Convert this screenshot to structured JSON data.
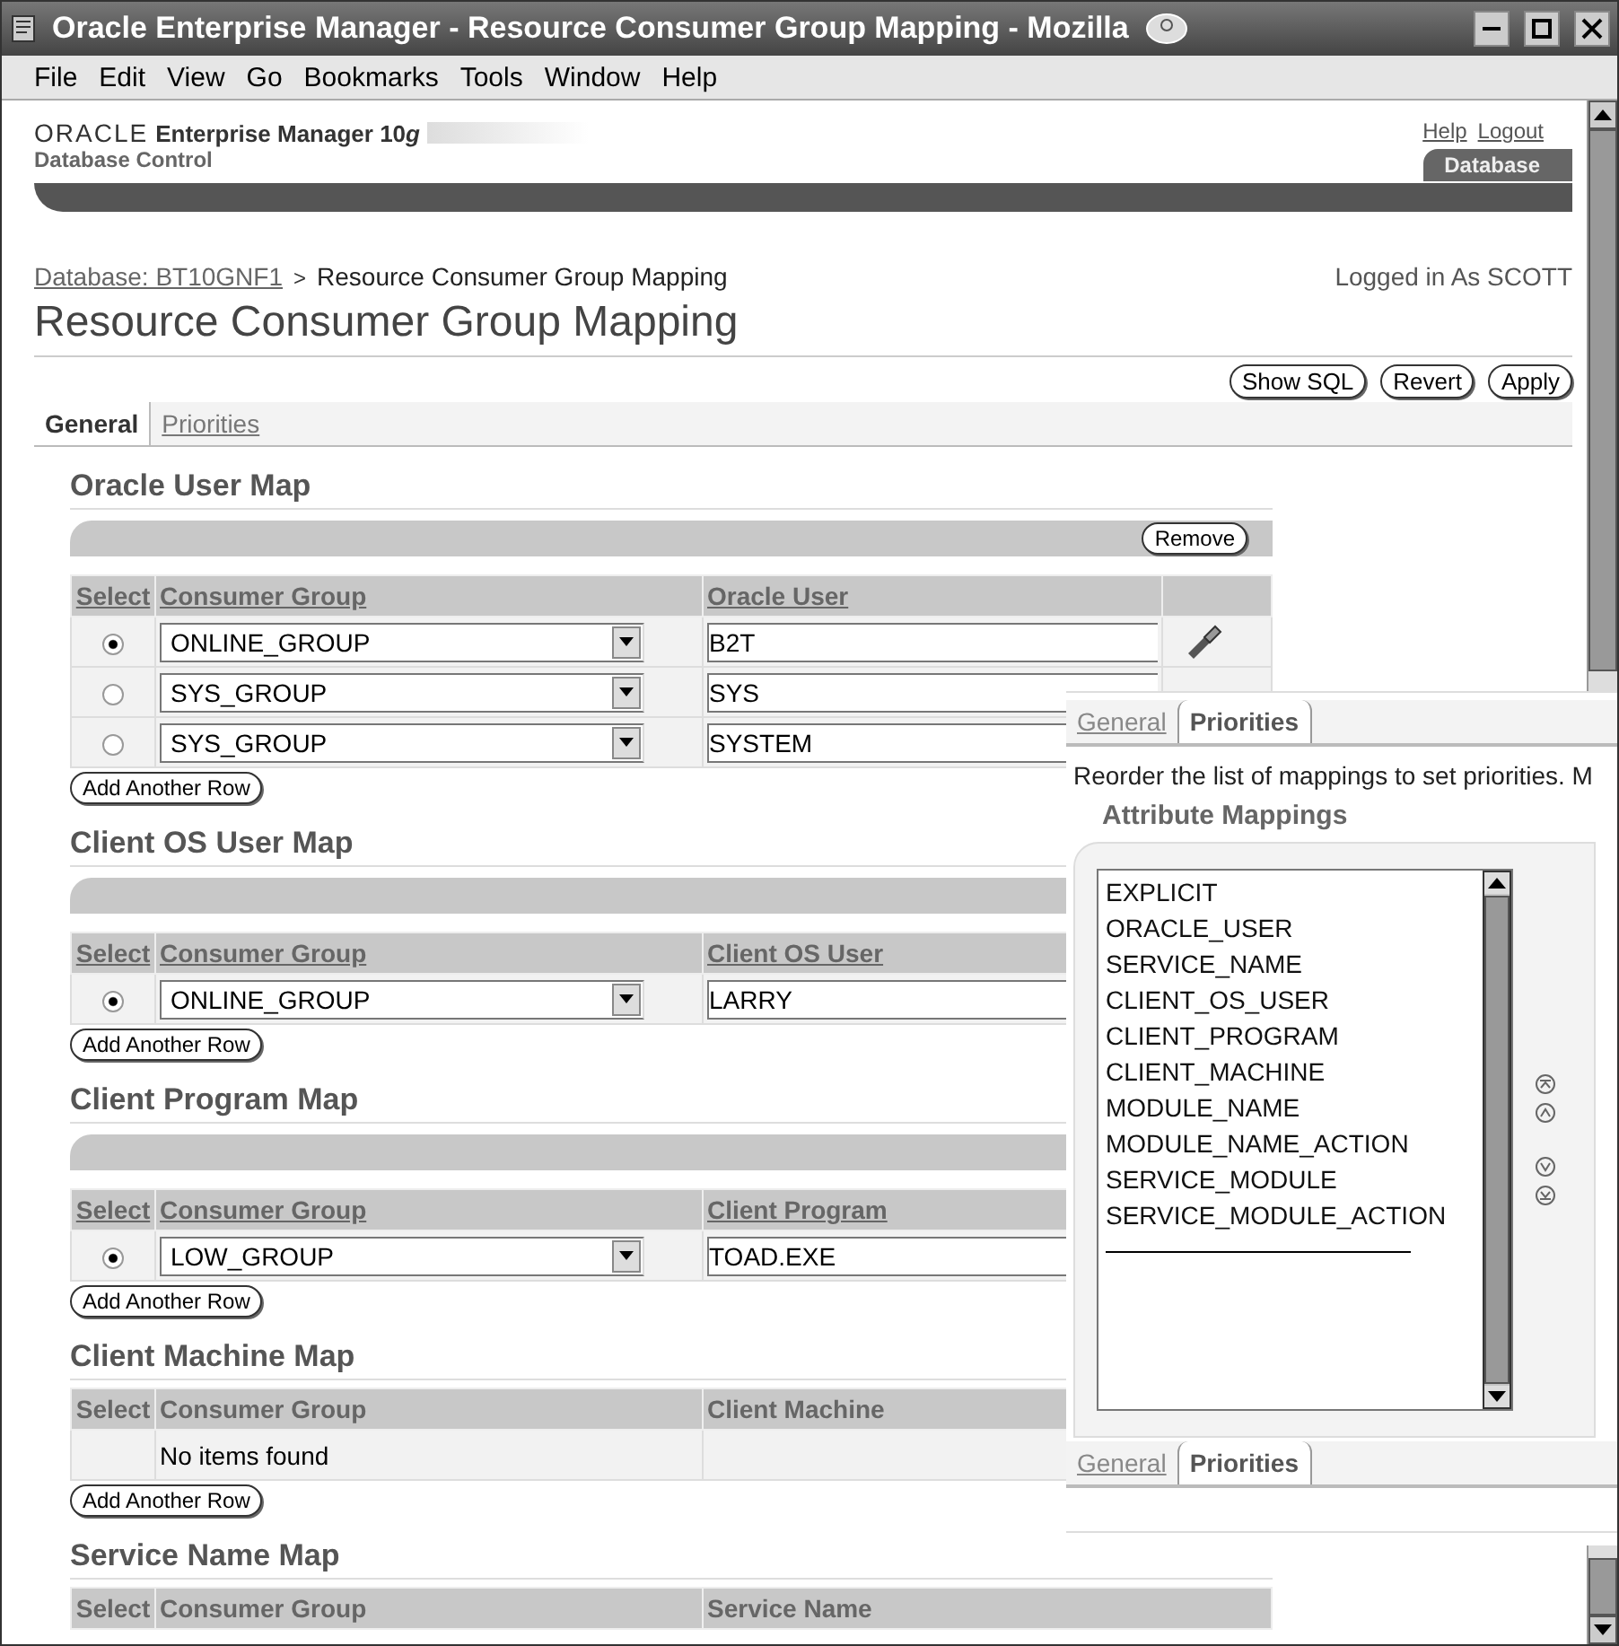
{
  "window": {
    "title": "Oracle Enterprise Manager - Resource Consumer Group Mapping - Mozilla"
  },
  "menu": [
    "File",
    "Edit",
    "View",
    "Go",
    "Bookmarks",
    "Tools",
    "Window",
    "Help"
  ],
  "header": {
    "brand": "ORACLE",
    "product": "Enterprise Manager 10",
    "version": "g",
    "subtitle": "Database Control",
    "links": [
      "Help",
      "Logout"
    ],
    "target_tab": "Database"
  },
  "breadcrumb": {
    "link": "Database: BT10GNF1",
    "separator": ">",
    "current": "Resource Consumer Group Mapping"
  },
  "logged_in": "Logged in As SCOTT",
  "page_title": "Resource Consumer Group Mapping",
  "actions": [
    "Show SQL",
    "Revert",
    "Apply"
  ],
  "tabs": [
    {
      "label": "General",
      "selected": true
    },
    {
      "label": "Priorities",
      "selected": false
    }
  ],
  "sections": [
    {
      "title": "Oracle User Map",
      "toolbar": true,
      "toolbar_button": "Remove",
      "lookup": true,
      "columns": [
        "Select",
        "Consumer Group",
        "Oracle User"
      ],
      "rows": [
        {
          "selected": true,
          "group": "ONLINE_GROUP",
          "value": "B2T"
        },
        {
          "selected": false,
          "group": "SYS_GROUP",
          "value": "SYS"
        },
        {
          "selected": false,
          "group": "SYS_GROUP",
          "value": "SYSTEM"
        }
      ],
      "add_button": "Add Another Row"
    },
    {
      "title": "Client OS User Map",
      "toolbar": true,
      "lookup": false,
      "columns": [
        "Select",
        "Consumer Group",
        "Client OS User"
      ],
      "rows": [
        {
          "selected": true,
          "group": "ONLINE_GROUP",
          "value": "LARRY"
        }
      ],
      "add_button": "Add Another Row"
    },
    {
      "title": "Client Program Map",
      "toolbar": true,
      "lookup": false,
      "columns": [
        "Select",
        "Consumer Group",
        "Client Program"
      ],
      "rows": [
        {
          "selected": true,
          "group": "LOW_GROUP",
          "value": "TOAD.EXE"
        }
      ],
      "add_button": "Add Another Row"
    },
    {
      "title": "Client Machine Map",
      "toolbar": false,
      "lookup": false,
      "columns": [
        "Select",
        "Consumer Group",
        "Client Machine"
      ],
      "empty_text": "No items found",
      "add_button": "Add Another Row"
    },
    {
      "title": "Service Name Map",
      "toolbar": false,
      "lookup": false,
      "columns": [
        "Select",
        "Consumer Group",
        "Service Name"
      ]
    }
  ],
  "overlay": {
    "tabs": [
      {
        "label": "General",
        "selected": false
      },
      {
        "label": "Priorities",
        "selected": true
      }
    ],
    "instruction": "Reorder the list of mappings to set priorities. M",
    "heading": "Attribute Mappings",
    "mappings": [
      "EXPLICIT",
      "ORACLE_USER",
      "SERVICE_NAME",
      "CLIENT_OS_USER",
      "CLIENT_PROGRAM",
      "CLIENT_MACHINE",
      "MODULE_NAME",
      "MODULE_NAME_ACTION",
      "SERVICE_MODULE",
      "SERVICE_MODULE_ACTION"
    ],
    "bottom_tabs": [
      {
        "label": "General",
        "selected": false
      },
      {
        "label": "Priorities",
        "selected": true
      }
    ]
  }
}
